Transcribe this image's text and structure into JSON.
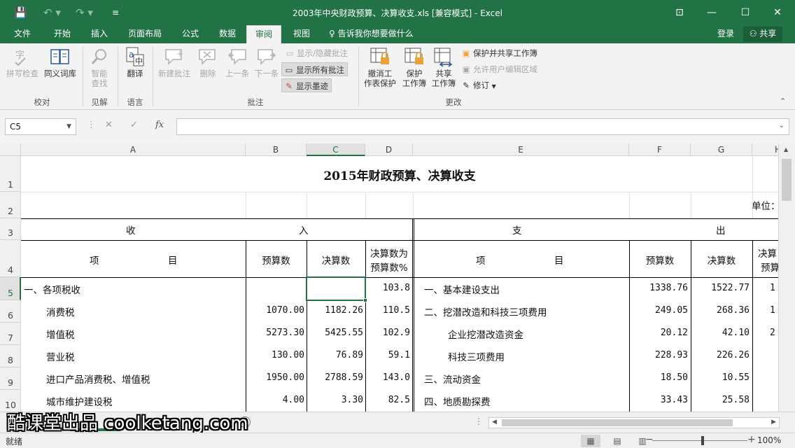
{
  "window": {
    "title": "2003年中央财政预算、决算收支.xls  [兼容模式] - Excel",
    "min": "—",
    "max": "☐",
    "close": "✕",
    "ribbon_opts": "⊡"
  },
  "qat": {
    "save": "💾",
    "undo": "↶ ▾",
    "redo": "↷ ▾",
    "customize": "≡"
  },
  "menu": {
    "tabs": [
      "文件",
      "开始",
      "插入",
      "页面布局",
      "公式",
      "数据",
      "审阅",
      "视图"
    ],
    "active": "审阅",
    "tell_me": "告诉我你想要做什么",
    "login": "登录",
    "share": "共享"
  },
  "ribbon": {
    "proofing": {
      "spell": "拼写检查",
      "thesaurus": "同义词库",
      "group": "校对"
    },
    "insights": {
      "smart_lookup_1": "智能",
      "smart_lookup_2": "查找",
      "group": "见解"
    },
    "language": {
      "translate": "翻译",
      "group": "语言"
    },
    "comments": {
      "new": "新建批注",
      "delete": "删除",
      "prev": "上一条",
      "next": "下一条",
      "show_hide": "显示/隐藏批注",
      "show_all": "显示所有批注",
      "show_ink": "显示墨迹",
      "group": "批注"
    },
    "changes": {
      "unprotect_1": "撤消工",
      "unprotect_2": "作表保护",
      "protect_wb_1": "保护",
      "protect_wb_2": "工作簿",
      "share_wb_1": "共享",
      "share_wb_2": "工作簿",
      "protect_share": "保护并共享工作簿",
      "allow_edit": "允许用户编辑区域",
      "track": "修订",
      "group": "更改"
    }
  },
  "formula_bar": {
    "name_box": "C5",
    "cancel": "✕",
    "enter": "✓",
    "fx": "fx",
    "value": ""
  },
  "grid": {
    "columns": [
      "A",
      "B",
      "C",
      "D",
      "E",
      "F",
      "G",
      "H"
    ],
    "rows": [
      "1",
      "2",
      "3",
      "4",
      "5",
      "6",
      "7",
      "8",
      "9",
      "10"
    ],
    "selected_cell": "C5",
    "title": "2015年财政预算、决算收支",
    "unit": "单位：",
    "income_head_1": "收",
    "income_head_2": "入",
    "expense_head_1": "支",
    "expense_head_2": "出",
    "h_item_1": "项",
    "h_item_2": "目",
    "h_budget": "预算数",
    "h_actual": "决算数",
    "h_ratio_1": "决算数为",
    "h_ratio_2": "预算数%",
    "h_ratio_e_1": "决算",
    "h_ratio_e_2": "预算",
    "income": [
      {
        "item": "一、各项税收",
        "budget": "",
        "actual": "",
        "ratio": "103.8"
      },
      {
        "item": "消费税",
        "budget": "1070.00",
        "actual": "1182.26",
        "ratio": "110.5"
      },
      {
        "item": "增值税",
        "budget": "5273.30",
        "actual": "5425.55",
        "ratio": "102.9"
      },
      {
        "item": "营业税",
        "budget": "130.00",
        "actual": "76.89",
        "ratio": "59.1"
      },
      {
        "item": "进口产品消费税、增值税",
        "budget": "1950.00",
        "actual": "2788.59",
        "ratio": "143.0"
      },
      {
        "item": "城市维护建设税",
        "budget": "4.00",
        "actual": "3.30",
        "ratio": "82.5"
      }
    ],
    "expense": [
      {
        "item": "一、基本建设支出",
        "budget": "1338.76",
        "actual": "1522.77",
        "ratio": "1"
      },
      {
        "item": "二、挖潜改造和科技三项费用",
        "budget": "249.05",
        "actual": "268.36",
        "ratio": "1"
      },
      {
        "item": "企业挖潜改造资金",
        "budget": "20.12",
        "actual": "42.10",
        "ratio": "2"
      },
      {
        "item": "科技三项费用",
        "budget": "228.93",
        "actual": "226.26",
        "ratio": ""
      },
      {
        "item": "三、流动资金",
        "budget": "18.50",
        "actual": "10.55",
        "ratio": ""
      },
      {
        "item": "四、地质勘探费",
        "budget": "33.43",
        "actual": "25.58",
        "ratio": ""
      }
    ]
  },
  "sheetbar": {
    "add": "+"
  },
  "watermark": "酷课堂出品 coolketang.com",
  "status": {
    "ready": "就绪",
    "zoom": "100%",
    "zoom_minus": "−",
    "zoom_plus": "+"
  }
}
